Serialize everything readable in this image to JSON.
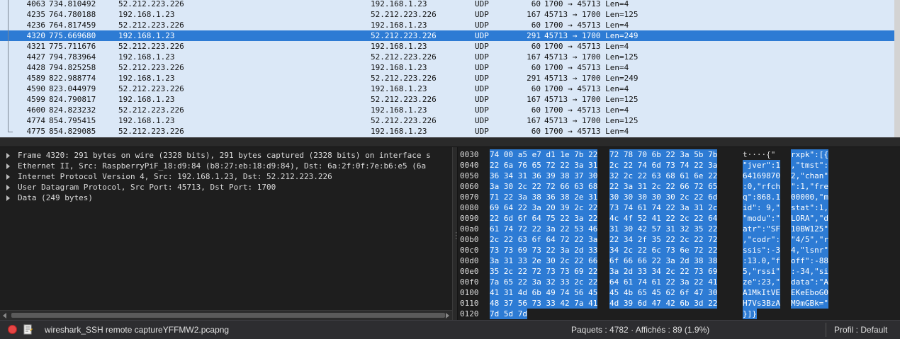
{
  "packets": [
    {
      "no": "4063",
      "time": "734.810492",
      "src": "52.212.223.226",
      "dst": "192.168.1.23",
      "proto": "UDP",
      "len": "60",
      "info": "1700 → 45713 Len=4",
      "selected": false
    },
    {
      "no": "4235",
      "time": "764.780188",
      "src": "192.168.1.23",
      "dst": "52.212.223.226",
      "proto": "UDP",
      "len": "167",
      "info": "45713 → 1700 Len=125",
      "selected": false
    },
    {
      "no": "4236",
      "time": "764.817459",
      "src": "52.212.223.226",
      "dst": "192.168.1.23",
      "proto": "UDP",
      "len": "60",
      "info": "1700 → 45713 Len=4",
      "selected": false
    },
    {
      "no": "4320",
      "time": "775.669680",
      "src": "192.168.1.23",
      "dst": "52.212.223.226",
      "proto": "UDP",
      "len": "291",
      "info": "45713 → 1700 Len=249",
      "selected": true
    },
    {
      "no": "4321",
      "time": "775.711676",
      "src": "52.212.223.226",
      "dst": "192.168.1.23",
      "proto": "UDP",
      "len": "60",
      "info": "1700 → 45713 Len=4",
      "selected": false
    },
    {
      "no": "4427",
      "time": "794.783964",
      "src": "192.168.1.23",
      "dst": "52.212.223.226",
      "proto": "UDP",
      "len": "167",
      "info": "45713 → 1700 Len=125",
      "selected": false
    },
    {
      "no": "4428",
      "time": "794.825258",
      "src": "52.212.223.226",
      "dst": "192.168.1.23",
      "proto": "UDP",
      "len": "60",
      "info": "1700 → 45713 Len=4",
      "selected": false
    },
    {
      "no": "4589",
      "time": "822.988774",
      "src": "192.168.1.23",
      "dst": "52.212.223.226",
      "proto": "UDP",
      "len": "291",
      "info": "45713 → 1700 Len=249",
      "selected": false
    },
    {
      "no": "4590",
      "time": "823.044979",
      "src": "52.212.223.226",
      "dst": "192.168.1.23",
      "proto": "UDP",
      "len": "60",
      "info": "1700 → 45713 Len=4",
      "selected": false
    },
    {
      "no": "4599",
      "time": "824.790817",
      "src": "192.168.1.23",
      "dst": "52.212.223.226",
      "proto": "UDP",
      "len": "167",
      "info": "45713 → 1700 Len=125",
      "selected": false
    },
    {
      "no": "4600",
      "time": "824.823232",
      "src": "52.212.223.226",
      "dst": "192.168.1.23",
      "proto": "UDP",
      "len": "60",
      "info": "1700 → 45713 Len=4",
      "selected": false
    },
    {
      "no": "4774",
      "time": "854.795415",
      "src": "192.168.1.23",
      "dst": "52.212.223.226",
      "proto": "UDP",
      "len": "167",
      "info": "45713 → 1700 Len=125",
      "selected": false
    },
    {
      "no": "4775",
      "time": "854.829085",
      "src": "52.212.223.226",
      "dst": "192.168.1.23",
      "proto": "UDP",
      "len": "60",
      "info": "1700 → 45713 Len=4",
      "selected": false
    }
  ],
  "details": [
    "Frame 4320: 291 bytes on wire (2328 bits), 291 bytes captured (2328 bits) on interface s",
    "Ethernet II, Src: RaspberryPiF_18:d9:84 (b8:27:eb:18:d9:84), Dst: 6a:2f:0f:7e:b6:e5 (6a",
    "Internet Protocol Version 4, Src: 192.168.1.23, Dst: 52.212.223.226",
    "User Datagram Protocol, Src Port: 45713, Dst Port: 1700",
    "Data (249 bytes)"
  ],
  "bytes": [
    {
      "offset": "0030",
      "hex1": "74 00 a5 e7 d1 1e 7b 22",
      "hex2": "72 78 70 6b 22 3a 5b 7b",
      "ascii_pre": "t····{\"",
      "ascii_post": "rxpk\":[{"
    },
    {
      "offset": "0040",
      "hex1": "22 6a 76 65 72 22 3a 31",
      "hex2": "2c 22 74 6d 73 74 22 3a",
      "ascii_pre": "\"jver\":1",
      "ascii_post": ",\"tmst\":"
    },
    {
      "offset": "0050",
      "hex1": "36 34 31 36 39 38 37 30",
      "hex2": "32 2c 22 63 68 61 6e 22",
      "ascii_pre": "64169870",
      "ascii_post": "2,\"chan\""
    },
    {
      "offset": "0060",
      "hex1": "3a 30 2c 22 72 66 63 68",
      "hex2": "22 3a 31 2c 22 66 72 65",
      "ascii_pre": ":0,\"rfch",
      "ascii_post": "\":1,\"fre"
    },
    {
      "offset": "0070",
      "hex1": "71 22 3a 38 36 38 2e 31",
      "hex2": "30 30 30 30 30 2c 22 6d",
      "ascii_pre": "q\":868.1",
      "ascii_post": "00000,\"m"
    },
    {
      "offset": "0080",
      "hex1": "69 64 22 3a 20 39 2c 22",
      "hex2": "73 74 61 74 22 3a 31 2c",
      "ascii_pre": "id\": 9,\"",
      "ascii_post": "stat\":1,"
    },
    {
      "offset": "0090",
      "hex1": "22 6d 6f 64 75 22 3a 22",
      "hex2": "4c 4f 52 41 22 2c 22 64",
      "ascii_pre": "\"modu\":\"",
      "ascii_post": "LORA\",\"d"
    },
    {
      "offset": "00a0",
      "hex1": "61 74 72 22 3a 22 53 46",
      "hex2": "31 30 42 57 31 32 35 22",
      "ascii_pre": "atr\":\"SF",
      "ascii_post": "10BW125\""
    },
    {
      "offset": "00b0",
      "hex1": "2c 22 63 6f 64 72 22 3a",
      "hex2": "22 34 2f 35 22 2c 22 72",
      "ascii_pre": ",\"codr\":",
      "ascii_post": "\"4/5\",\"r"
    },
    {
      "offset": "00c0",
      "hex1": "73 73 69 73 22 3a 2d 33",
      "hex2": "34 2c 22 6c 73 6e 72 22",
      "ascii_pre": "ssis\":-3",
      "ascii_post": "4,\"lsnr\""
    },
    {
      "offset": "00d0",
      "hex1": "3a 31 33 2e 30 2c 22 66",
      "hex2": "6f 66 66 22 3a 2d 38 38",
      "ascii_pre": ":13.0,\"f",
      "ascii_post": "off\":-88"
    },
    {
      "offset": "00e0",
      "hex1": "35 2c 22 72 73 73 69 22",
      "hex2": "3a 2d 33 34 2c 22 73 69",
      "ascii_pre": "5,\"rssi\"",
      "ascii_post": ":-34,\"si"
    },
    {
      "offset": "00f0",
      "hex1": "7a 65 22 3a 32 33 2c 22",
      "hex2": "64 61 74 61 22 3a 22 41",
      "ascii_pre": "ze\":23,\"",
      "ascii_post": "data\":\"A"
    },
    {
      "offset": "0100",
      "hex1": "41 31 4d 6b 49 74 56 45",
      "hex2": "45 4b 65 45 62 6f 47 30",
      "ascii_pre": "A1MkItVE",
      "ascii_post": "EKeEboG0"
    },
    {
      "offset": "0110",
      "hex1": "48 37 56 73 33 42 7a 41",
      "hex2": "4d 39 6d 47 42 6b 3d 22",
      "ascii_pre": "H7Vs3BzA",
      "ascii_post": "M9mGBk=\""
    },
    {
      "offset": "0120",
      "hex1": "7d 5d 7d",
      "hex2": "",
      "ascii_pre": "}]}",
      "ascii_post": ""
    }
  ],
  "status": {
    "file": "wireshark_SSH remote captureYFFMW2.pcapng",
    "packets": "Paquets : 4782 · Affichés : 89 (1.9%)",
    "profile": "Profil : Default"
  },
  "colors": {
    "list_bg": "#dbe8f7",
    "selection": "#2d7bd4",
    "pane_bg": "#1e1e1e",
    "capture_stop": "#e64545"
  }
}
